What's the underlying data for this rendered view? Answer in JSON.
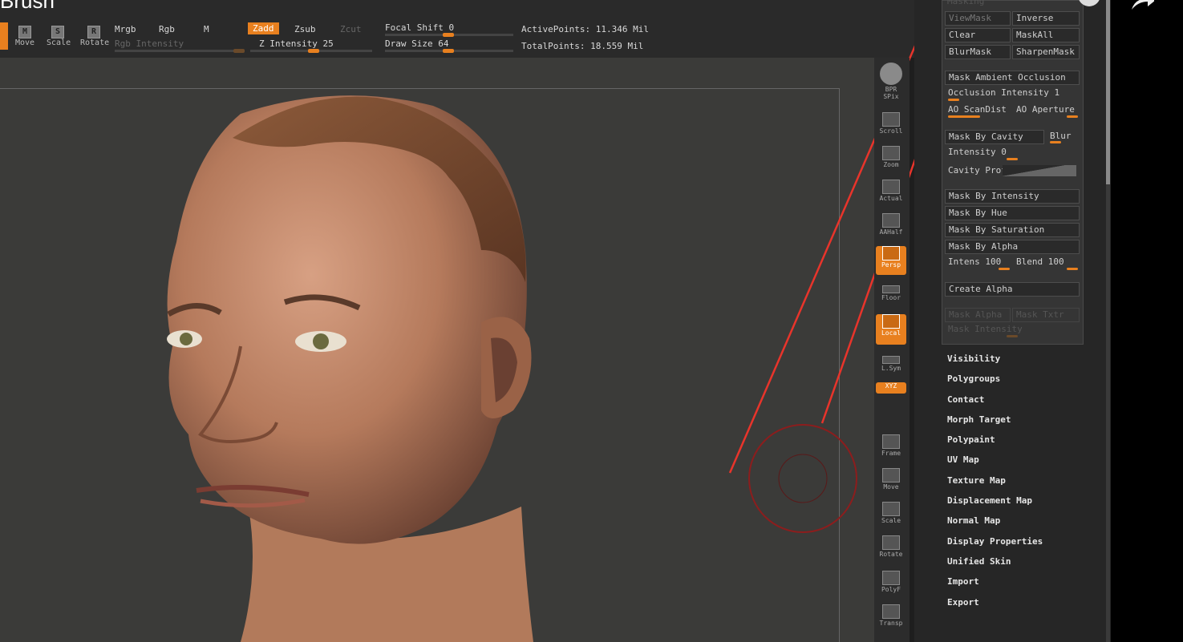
{
  "video_title_fragment": "Brush",
  "toolbar": {
    "transform_buttons": [
      {
        "icon": "move-icon",
        "letter": "M",
        "label": "Move"
      },
      {
        "icon": "scale-icon",
        "letter": "S",
        "label": "Scale"
      },
      {
        "icon": "rotate-icon",
        "letter": "R",
        "label": "Rotate"
      }
    ],
    "mrgb": "Mrgb",
    "rgb": "Rgb",
    "m": "M",
    "rgb_intensity": "Rgb Intensity",
    "zadd": "Zadd",
    "zsub": "Zsub",
    "zcut": "Zcut",
    "z_intensity": "Z Intensity 25",
    "focal_shift": "Focal Shift 0",
    "draw_size": "Draw Size 64",
    "active_points": "ActivePoints: 11.346 Mil",
    "total_points": "TotalPoints: 18.559 Mil"
  },
  "shelf": [
    {
      "name": "bpr-button",
      "label": "BPR",
      "on": false
    },
    {
      "name": "spix-button",
      "label": "SPix",
      "on": false
    },
    {
      "name": "scroll-button",
      "label": "Scroll",
      "on": false
    },
    {
      "name": "zoom-button",
      "label": "Zoom",
      "on": false
    },
    {
      "name": "actual-button",
      "label": "Actual",
      "on": false
    },
    {
      "name": "aahalf-button",
      "label": "AAHalf",
      "on": false
    },
    {
      "name": "persp-button",
      "label": "Persp",
      "on": true
    },
    {
      "name": "floor-button",
      "label": "Floor",
      "on": false
    },
    {
      "name": "local-button",
      "label": "Local",
      "on": true
    },
    {
      "name": "lsym-button",
      "label": "L.Sym",
      "on": false
    },
    {
      "name": "xyz-button",
      "label": "XYZ",
      "on": true
    },
    {
      "name": "frame-button",
      "label": "Frame",
      "on": false
    },
    {
      "name": "move-view-button",
      "label": "Move",
      "on": false
    },
    {
      "name": "scale-view-button",
      "label": "Scale",
      "on": false
    },
    {
      "name": "rotate-view-button",
      "label": "Rotate",
      "on": false
    },
    {
      "name": "polyf-button",
      "label": "PolyF",
      "on": false
    },
    {
      "name": "transp-button",
      "label": "Transp",
      "on": false
    }
  ],
  "masking": {
    "header": "Masking",
    "viewmask": "ViewMask",
    "inverse": "Inverse",
    "clear": "Clear",
    "maskall": "MaskAll",
    "blurmask": "BlurMask",
    "sharpenmask": "SharpenMask",
    "mask_ambient_occlusion": "Mask Ambient Occlusion",
    "occlusion_intensity": "Occlusion Intensity 1",
    "ao_scandist": "AO ScanDist",
    "ao_aperture": "AO Aperture",
    "mask_by_cavity": "Mask By Cavity",
    "blur": "Blur",
    "intensity": "Intensity 0",
    "cavity_profile": "Cavity Profile",
    "mask_by_intensity": "Mask By Intensity",
    "mask_by_hue": "Mask By Hue",
    "mask_by_saturation": "Mask By Saturation",
    "mask_by_alpha": "Mask By Alpha",
    "intens": "Intens 100",
    "blend": "Blend 100",
    "create_alpha": "Create Alpha",
    "mask_alpha": "Mask Alpha",
    "mask_txtr": "Mask Txtr",
    "mask_intensity": "Mask Intensity"
  },
  "subpalettes": [
    "Visibility",
    "Polygroups",
    "Contact",
    "Morph Target",
    "Polypaint",
    "UV Map",
    "Texture Map",
    "Displacement Map",
    "Normal Map",
    "Display Properties",
    "Unified Skin",
    "Import",
    "Export"
  ],
  "colors": {
    "accent": "#e8801f",
    "annotation_arrow": "#e8342b",
    "brush_cursor": "#8c1d1d"
  }
}
